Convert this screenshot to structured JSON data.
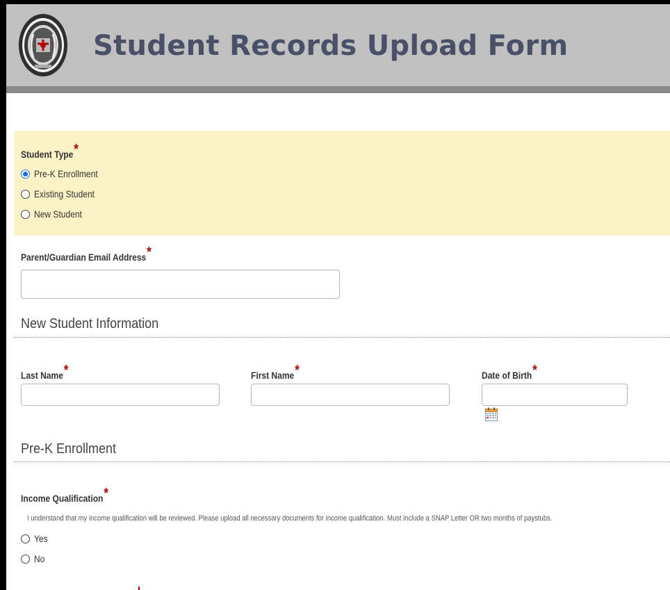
{
  "header": {
    "title": "Student Records Upload Form"
  },
  "student_type": {
    "label": "Student Type",
    "required": "*",
    "options": [
      {
        "label": "Pre-K Enrollment",
        "checked": true
      },
      {
        "label": "Existing Student",
        "checked": false
      },
      {
        "label": "New Student",
        "checked": false
      }
    ]
  },
  "email": {
    "label": "Parent/Guardian Email Address",
    "required": "*",
    "value": ""
  },
  "new_student_section": {
    "heading": "New Student Information",
    "last_name": {
      "label": "Last Name",
      "required": "*",
      "value": ""
    },
    "first_name": {
      "label": "First Name",
      "required": "*",
      "value": ""
    },
    "date_of_birth": {
      "label": "Date of Birth",
      "required": "*",
      "value": ""
    }
  },
  "prek_section": {
    "heading": "Pre-K Enrollment"
  },
  "income": {
    "label": "Income Qualification",
    "required": "*",
    "description": "I understand that my income qualification will be reviewed. Please upload all necessary documents for income qualification. Must include a SNAP Letter OR two months of paystubs.",
    "options": [
      {
        "label": "Yes",
        "checked": false
      },
      {
        "label": "No",
        "checked": false
      }
    ]
  },
  "colors": {
    "header_bg": "#c0c0c0",
    "title": "#4a5068",
    "panel_bg": "#fbf3c6",
    "required": "#b00000",
    "radio_selected": "#1a73e8"
  },
  "icons": {
    "seal": "school-seal-icon",
    "calendar": "calendar-icon"
  }
}
